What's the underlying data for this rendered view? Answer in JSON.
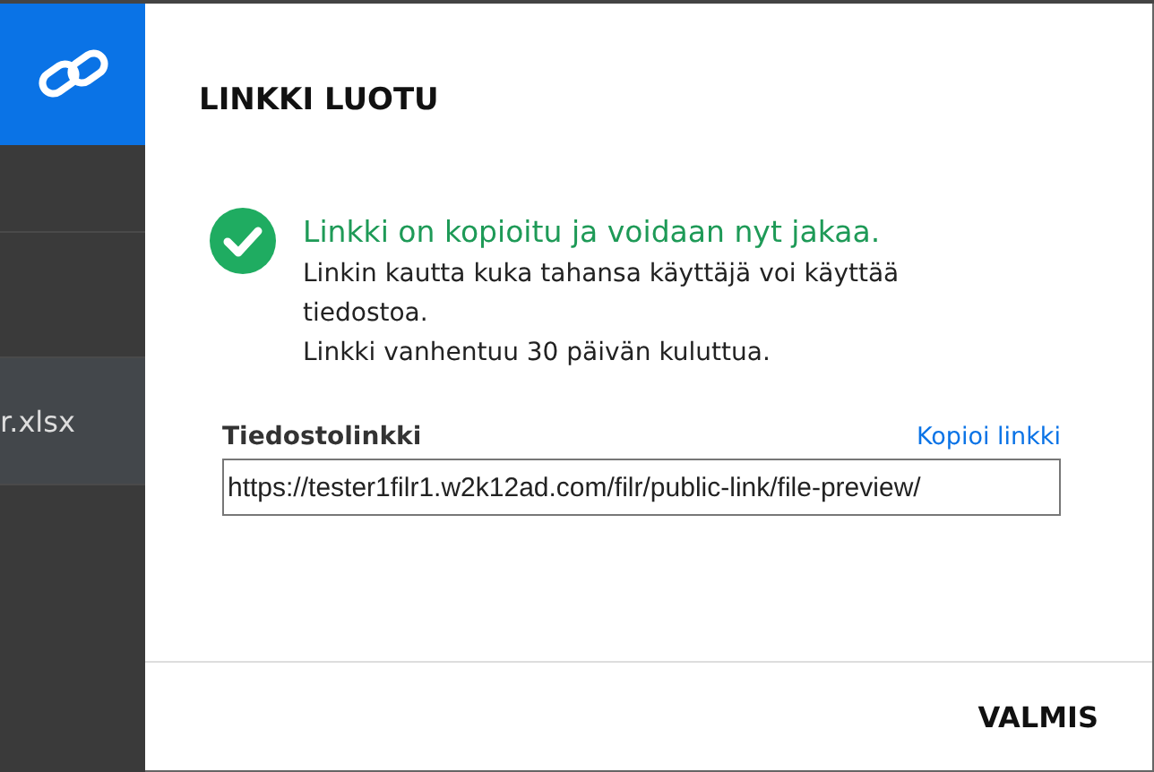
{
  "background_list": {
    "rows": [
      {
        "label": "",
        "selected": false
      },
      {
        "label": "",
        "selected": false
      },
      {
        "label": "r.xlsx",
        "selected": true
      }
    ]
  },
  "dialog": {
    "title": "LINKKI LUOTU",
    "message": {
      "headline": "Linkki on kopioitu ja voidaan nyt jakaa.",
      "lines": [
        "Linkin kautta kuka tahansa käyttäjä voi käyttää tiedostoa.",
        "Linkki vanhentuu 30 päivän kuluttua."
      ]
    },
    "field": {
      "label": "Tiedostolinkki",
      "action": "Kopioi linkki",
      "value": "https://tester1filr1.w2k12ad.com/filr/public-link/file-preview/"
    },
    "buttons": [
      "VALMIS"
    ]
  }
}
